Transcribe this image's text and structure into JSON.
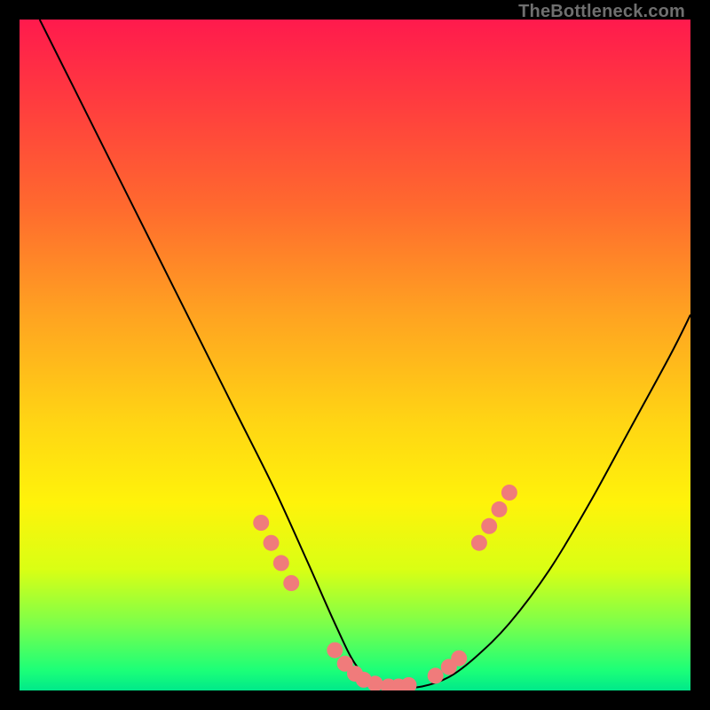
{
  "watermark": "TheBottleneck.com",
  "chart_data": {
    "type": "line",
    "title": "",
    "xlabel": "",
    "ylabel": "",
    "xlim": [
      0,
      100
    ],
    "ylim": [
      0,
      100
    ],
    "series": [
      {
        "name": "curve",
        "x": [
          3,
          8,
          14,
          20,
          26,
          32,
          38,
          43,
          47,
          50,
          53,
          56,
          60,
          64,
          68,
          73,
          79,
          85,
          91,
          97,
          100
        ],
        "y": [
          100,
          90,
          78,
          66,
          54,
          42,
          30,
          19,
          10,
          4,
          1,
          0.4,
          0.6,
          2,
          5,
          10,
          18,
          28,
          39,
          50,
          56
        ]
      }
    ],
    "markers": [
      {
        "x": 36.0,
        "y": 25.0
      },
      {
        "x": 37.5,
        "y": 22.0
      },
      {
        "x": 39.0,
        "y": 19.0
      },
      {
        "x": 40.5,
        "y": 16.0
      },
      {
        "x": 47.0,
        "y": 6.0
      },
      {
        "x": 48.5,
        "y": 4.0
      },
      {
        "x": 50.0,
        "y": 2.5
      },
      {
        "x": 51.3,
        "y": 1.6
      },
      {
        "x": 53.0,
        "y": 1.0
      },
      {
        "x": 55.0,
        "y": 0.6
      },
      {
        "x": 56.5,
        "y": 0.6
      },
      {
        "x": 58.0,
        "y": 0.8
      },
      {
        "x": 62.0,
        "y": 2.2
      },
      {
        "x": 64.0,
        "y": 3.5
      },
      {
        "x": 65.5,
        "y": 4.8
      },
      {
        "x": 68.5,
        "y": 22.0
      },
      {
        "x": 70.0,
        "y": 24.5
      },
      {
        "x": 71.5,
        "y": 27.0
      },
      {
        "x": 73.0,
        "y": 29.5
      }
    ],
    "marker_radius_px": 9,
    "curve_stroke_px": 2,
    "curve_color": "#000000",
    "marker_color": "#f07b7b"
  }
}
